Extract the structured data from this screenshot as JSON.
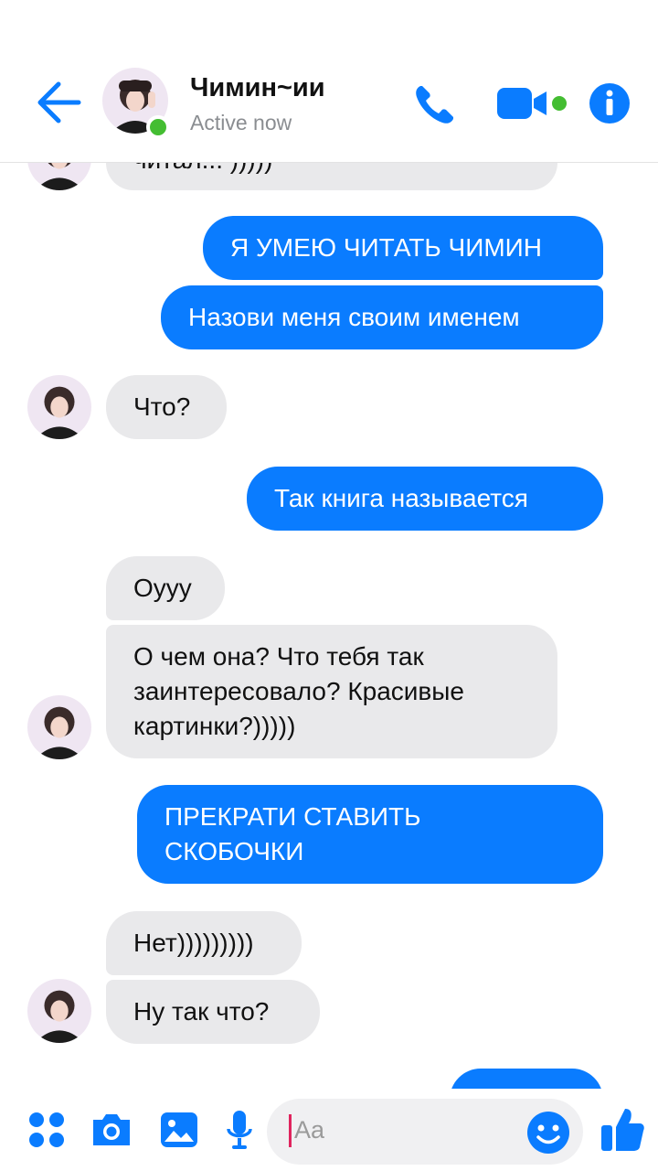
{
  "header": {
    "contact_name": "Чимин~ии",
    "status": "Active now"
  },
  "colors": {
    "accent": "#0a7cff",
    "online": "#44bd32",
    "incoming_bubble": "#e9e9eb"
  },
  "messages": [
    {
      "from": "them",
      "text": "читал... )))))",
      "partial": true
    },
    {
      "from": "me",
      "text": "Я УМЕЮ ЧИТАТЬ ЧИМИН"
    },
    {
      "from": "me",
      "text": "Назови меня своим именем"
    },
    {
      "from": "them",
      "text": "Что?"
    },
    {
      "from": "me",
      "text": "Так книга называется"
    },
    {
      "from": "them",
      "text": "Оууу"
    },
    {
      "from": "them",
      "text_lines": [
        "О чем она? Что тебя так",
        "заинтересовало? Красивые",
        "картинки?)))))"
      ]
    },
    {
      "from": "me",
      "text_lines": [
        "ПРЕКРАТИ СТАВИТЬ",
        "СКОБОЧКИ"
      ]
    },
    {
      "from": "them",
      "text": "Нет)))))))))"
    },
    {
      "from": "them",
      "text": "Ну так что?"
    },
    {
      "from": "me",
      "text": "",
      "partial": true
    }
  ],
  "composer": {
    "placeholder": "Aa",
    "icons": [
      "apps-icon",
      "camera-icon",
      "gallery-icon",
      "microphone-icon",
      "emoji-icon",
      "thumbs-up-icon"
    ]
  }
}
